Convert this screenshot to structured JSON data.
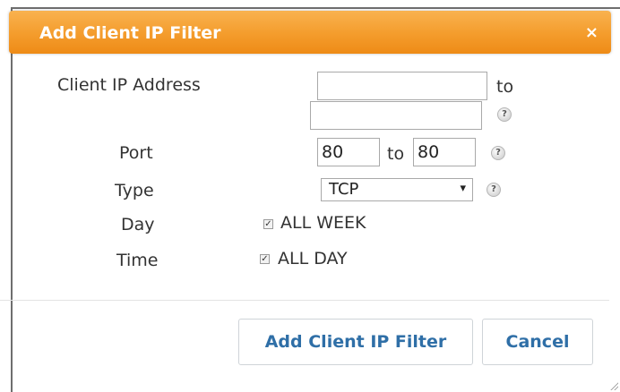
{
  "dialog": {
    "title": "Add Client IP Filter",
    "close_label": "×"
  },
  "form": {
    "client_ip_label": "Client IP Address",
    "client_ip_start": "",
    "to_label": "to",
    "client_ip_end": "",
    "port_label": "Port",
    "port_start": "80",
    "port_to_label": "to",
    "port_end": "80",
    "type_label": "Type",
    "type_value": "TCP",
    "day_label": "Day",
    "day_option": "ALL WEEK",
    "day_checked": true,
    "time_label": "Time",
    "time_option": "ALL DAY",
    "time_checked": true,
    "help_glyph": "?"
  },
  "buttons": {
    "submit_label": "Add Client IP Filter",
    "cancel_label": "Cancel"
  },
  "colors": {
    "titlebar": "#f49c2c",
    "button_text": "#2f6fa7"
  }
}
